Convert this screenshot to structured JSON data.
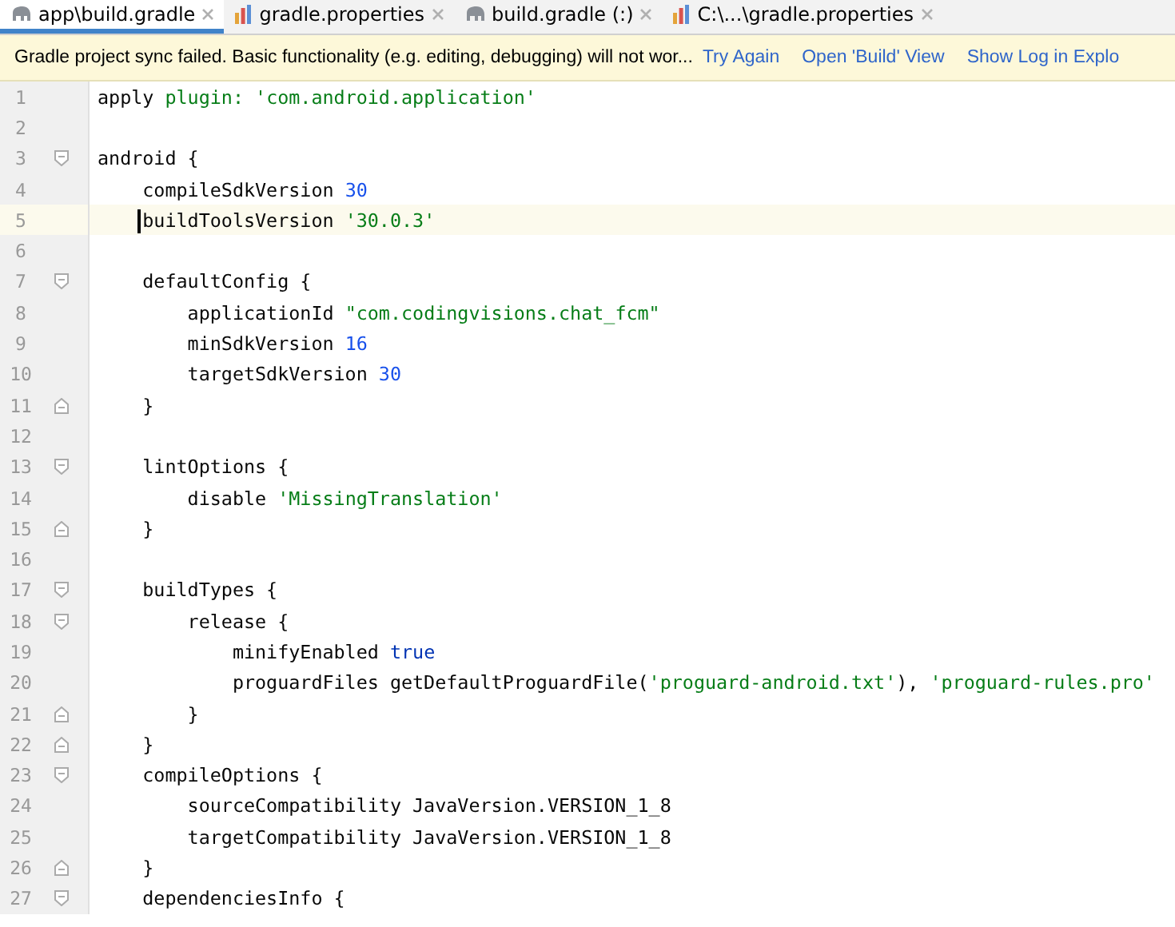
{
  "tabs": [
    {
      "label": "app\\build.gradle",
      "kind": "gradle",
      "selected": true
    },
    {
      "label": "gradle.properties",
      "kind": "properties",
      "selected": false
    },
    {
      "label": "build.gradle (:)",
      "kind": "gradle",
      "selected": false
    },
    {
      "label": "C:\\...\\gradle.properties",
      "kind": "properties",
      "selected": false
    }
  ],
  "banner": {
    "message": "Gradle project sync failed. Basic functionality (e.g. editing, debugging) will not wor...",
    "links": [
      "Try Again",
      "Open 'Build' View",
      "Show Log in Explo"
    ]
  },
  "lines": [
    {
      "number": "1",
      "kind": "plain",
      "current": false,
      "segments": [
        {
          "kind": "plain",
          "text": "apply "
        },
        {
          "kind": "string",
          "text": "plugin: 'com.android.application'"
        }
      ]
    },
    {
      "number": "2",
      "kind": "plain",
      "current": false
    },
    {
      "number": "3",
      "kind": "fold-start",
      "current": false,
      "segments": [
        {
          "kind": "plain",
          "text": "android {"
        }
      ]
    },
    {
      "number": "4",
      "kind": "plain",
      "current": false,
      "segments": [
        {
          "kind": "plain",
          "text": "    compileSdkVersion "
        },
        {
          "kind": "number",
          "text": "30"
        }
      ]
    },
    {
      "number": "5",
      "kind": "plain",
      "current": true,
      "segments": [
        {
          "kind": "plain",
          "text": "    buildToolsVersion "
        },
        {
          "kind": "string",
          "text": "'30.0.3'"
        }
      ]
    },
    {
      "number": "6",
      "kind": "plain",
      "current": false
    },
    {
      "number": "7",
      "kind": "fold-start",
      "current": false,
      "segments": [
        {
          "kind": "plain",
          "text": "    defaultConfig {"
        }
      ]
    },
    {
      "number": "8",
      "kind": "plain",
      "current": false,
      "segments": [
        {
          "kind": "plain",
          "text": "        applicationId "
        },
        {
          "kind": "string",
          "text": "\"com.codingvisions.chat_fcm\""
        }
      ]
    },
    {
      "number": "9",
      "kind": "plain",
      "current": false,
      "segments": [
        {
          "kind": "plain",
          "text": "        minSdkVersion "
        },
        {
          "kind": "number",
          "text": "16"
        }
      ]
    },
    {
      "number": "10",
      "kind": "plain",
      "current": false,
      "segments": [
        {
          "kind": "plain",
          "text": "        targetSdkVersion "
        },
        {
          "kind": "number",
          "text": "30"
        }
      ]
    },
    {
      "number": "11",
      "kind": "fold-end",
      "current": false,
      "segments": [
        {
          "kind": "plain",
          "text": "    }"
        }
      ]
    },
    {
      "number": "12",
      "kind": "plain",
      "current": false
    },
    {
      "number": "13",
      "kind": "fold-start",
      "current": false,
      "segments": [
        {
          "kind": "plain",
          "text": "    lintOptions {"
        }
      ]
    },
    {
      "number": "14",
      "kind": "plain",
      "current": false,
      "segments": [
        {
          "kind": "plain",
          "text": "        disable "
        },
        {
          "kind": "string",
          "text": "'MissingTranslation'"
        }
      ]
    },
    {
      "number": "15",
      "kind": "fold-end",
      "current": false,
      "segments": [
        {
          "kind": "plain",
          "text": "    }"
        }
      ]
    },
    {
      "number": "16",
      "kind": "plain",
      "current": false
    },
    {
      "number": "17",
      "kind": "fold-start",
      "current": false,
      "segments": [
        {
          "kind": "plain",
          "text": "    buildTypes {"
        }
      ]
    },
    {
      "number": "18",
      "kind": "fold-start",
      "current": false,
      "segments": [
        {
          "kind": "plain",
          "text": "        release {"
        }
      ]
    },
    {
      "number": "19",
      "kind": "plain",
      "current": false,
      "segments": [
        {
          "kind": "plain",
          "text": "            minifyEnabled "
        },
        {
          "kind": "keyword",
          "text": "true"
        }
      ]
    },
    {
      "number": "20",
      "kind": "plain",
      "current": false,
      "segments": [
        {
          "kind": "plain",
          "text": "            proguardFiles getDefaultProguardFile("
        },
        {
          "kind": "string",
          "text": "'proguard-android.txt'"
        },
        {
          "kind": "plain",
          "text": "), "
        },
        {
          "kind": "string",
          "text": "'proguard-rules.pro'"
        }
      ]
    },
    {
      "number": "21",
      "kind": "fold-end",
      "current": false,
      "segments": [
        {
          "kind": "plain",
          "text": "        }"
        }
      ]
    },
    {
      "number": "22",
      "kind": "fold-end",
      "current": false,
      "segments": [
        {
          "kind": "plain",
          "text": "    }"
        }
      ]
    },
    {
      "number": "23",
      "kind": "fold-start",
      "current": false,
      "segments": [
        {
          "kind": "plain",
          "text": "    compileOptions {"
        }
      ]
    },
    {
      "number": "24",
      "kind": "plain",
      "current": false,
      "segments": [
        {
          "kind": "plain",
          "text": "        sourceCompatibility JavaVersion.VERSION_1_8"
        }
      ]
    },
    {
      "number": "25",
      "kind": "plain",
      "current": false,
      "segments": [
        {
          "kind": "plain",
          "text": "        targetCompatibility JavaVersion.VERSION_1_8"
        }
      ]
    },
    {
      "number": "26",
      "kind": "fold-end",
      "current": false,
      "segments": [
        {
          "kind": "plain",
          "text": "    }"
        }
      ]
    },
    {
      "number": "27",
      "kind": "fold-start",
      "current": false,
      "segments": [
        {
          "kind": "plain",
          "text": "    dependenciesInfo {"
        }
      ]
    }
  ]
}
